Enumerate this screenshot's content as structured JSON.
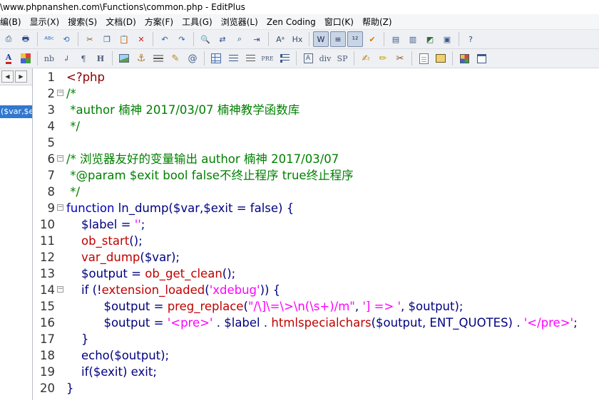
{
  "window": {
    "title": "\\www.phpnanshen.com\\Functions\\common.php - EditPlus"
  },
  "menu": [
    "编(B)",
    "显示(X)",
    "搜索(S)",
    "文档(D)",
    "方案(F)",
    "工具(G)",
    "浏览器(L)",
    "Zen Coding",
    "窗口(K)",
    "帮助(Z)"
  ],
  "toolbar_top": {
    "buttons": [
      {
        "name": "print-preview-icon",
        "glyph": "⎙"
      },
      {
        "name": "print-icon",
        "glyph": "🖶"
      },
      {
        "name": "spell-check-icon",
        "glyph": "ᴬᴮᶜ"
      },
      {
        "name": "reload-icon",
        "glyph": "⟲"
      },
      {
        "name": "cut-icon",
        "glyph": "✂"
      },
      {
        "name": "copy-icon",
        "glyph": "❐"
      },
      {
        "name": "paste-icon",
        "glyph": "📋"
      },
      {
        "name": "delete-icon",
        "glyph": "✕"
      },
      {
        "name": "undo-icon",
        "glyph": "↶"
      },
      {
        "name": "redo-icon",
        "glyph": "↷"
      },
      {
        "name": "find-icon",
        "glyph": "🔍"
      },
      {
        "name": "replace-icon",
        "glyph": "⇄"
      },
      {
        "name": "find-in-files-icon",
        "glyph": "⌕"
      },
      {
        "name": "goto-icon",
        "glyph": "⇥"
      },
      {
        "name": "font-size-icon",
        "glyph": "Aᵃ"
      },
      {
        "name": "hex-icon",
        "glyph": "Hx"
      },
      {
        "name": "word-wrap-icon",
        "glyph": "W"
      },
      {
        "name": "line-number-icon",
        "glyph": "≡"
      },
      {
        "name": "ruler-icon",
        "glyph": "¹²"
      },
      {
        "name": "check-icon",
        "glyph": "✔"
      },
      {
        "name": "window-list-icon",
        "glyph": "▤"
      },
      {
        "name": "split-window-icon",
        "glyph": "▥"
      },
      {
        "name": "browser-preview-icon",
        "glyph": "◩"
      },
      {
        "name": "tile-icon",
        "glyph": "▣"
      },
      {
        "name": "help-icon",
        "glyph": "?"
      }
    ]
  },
  "toolbar_html": {
    "font_color_label": "A",
    "nbsp_label": "nb",
    "br_label": "↲",
    "para_label": "¶",
    "heading_label": "H",
    "div_label": "div",
    "span_label": "SP",
    "pre_label": "PRE"
  },
  "sidebar": {
    "function_entry": "($var,$exit = false)"
  },
  "code_lines": [
    {
      "n": "1",
      "fold": false,
      "tokens": [
        [
          "<?php",
          "t-tag"
        ]
      ]
    },
    {
      "n": "2",
      "fold": true,
      "tokens": [
        [
          "/*",
          "t-com"
        ]
      ]
    },
    {
      "n": "3",
      "fold": false,
      "tokens": [
        [
          " *author 楠神 2017/03/07 楠神教学函数库",
          "t-com"
        ]
      ]
    },
    {
      "n": "4",
      "fold": false,
      "tokens": [
        [
          " */",
          "t-com"
        ]
      ]
    },
    {
      "n": "5",
      "fold": false,
      "tokens": []
    },
    {
      "n": "6",
      "fold": true,
      "tokens": [
        [
          "/* 浏览器友好的变量输出 author 楠神 2017/03/07",
          "t-com"
        ]
      ]
    },
    {
      "n": "7",
      "fold": false,
      "tokens": [
        [
          " *@param $exit bool false不终止程序 true终止程序",
          "t-com"
        ]
      ]
    },
    {
      "n": "8",
      "fold": false,
      "tokens": [
        [
          " */",
          "t-com"
        ]
      ]
    },
    {
      "n": "9",
      "fold": true,
      "tokens": [
        [
          "function ",
          "t-kw"
        ],
        [
          "ln_dump(",
          "t-plain"
        ],
        [
          "$var",
          "t-var"
        ],
        [
          ",",
          "t-plain"
        ],
        [
          "$exit",
          "t-var"
        ],
        [
          " = false) {",
          "t-plain"
        ]
      ]
    },
    {
      "n": "10",
      "fold": false,
      "tokens": [
        [
          "    $label",
          "t-var"
        ],
        [
          " = ",
          "t-plain"
        ],
        [
          "''",
          "t-str"
        ],
        [
          ";",
          "t-plain"
        ]
      ]
    },
    {
      "n": "11",
      "fold": false,
      "tokens": [
        [
          "    ob_start",
          "t-fn"
        ],
        [
          "();",
          "t-plain"
        ]
      ]
    },
    {
      "n": "12",
      "fold": false,
      "tokens": [
        [
          "    var_dump",
          "t-fn"
        ],
        [
          "(",
          "t-plain"
        ],
        [
          "$var",
          "t-var"
        ],
        [
          ");",
          "t-plain"
        ]
      ]
    },
    {
      "n": "13",
      "fold": false,
      "tokens": [
        [
          "    $output",
          "t-var"
        ],
        [
          " = ",
          "t-plain"
        ],
        [
          "ob_get_clean",
          "t-fn"
        ],
        [
          "();",
          "t-plain"
        ]
      ]
    },
    {
      "n": "14",
      "fold": true,
      "tokens": [
        [
          "    if (!",
          "t-plain"
        ],
        [
          "extension_loaded",
          "t-fn"
        ],
        [
          "(",
          "t-plain"
        ],
        [
          "'xdebug'",
          "t-str"
        ],
        [
          ")) {",
          "t-plain"
        ]
      ]
    },
    {
      "n": "15",
      "fold": false,
      "tokens": [
        [
          "          $output",
          "t-var"
        ],
        [
          " = ",
          "t-plain"
        ],
        [
          "preg_replace",
          "t-fn"
        ],
        [
          "(",
          "t-plain"
        ],
        [
          "\"/\\]\\=\\>\\n(\\s+)/m\"",
          "t-str"
        ],
        [
          ", ",
          "t-plain"
        ],
        [
          "'] => '",
          "t-str"
        ],
        [
          ", ",
          "t-plain"
        ],
        [
          "$output",
          "t-var"
        ],
        [
          ");",
          "t-plain"
        ]
      ]
    },
    {
      "n": "16",
      "fold": false,
      "tokens": [
        [
          "          $output",
          "t-var"
        ],
        [
          " = ",
          "t-plain"
        ],
        [
          "'<pre>'",
          "t-str"
        ],
        [
          " . ",
          "t-plain"
        ],
        [
          "$label",
          "t-var"
        ],
        [
          " . ",
          "t-plain"
        ],
        [
          "htmlspecialchars",
          "t-fn"
        ],
        [
          "(",
          "t-plain"
        ],
        [
          "$output",
          "t-var"
        ],
        [
          ", ENT_QUOTES) . ",
          "t-plain"
        ],
        [
          "'</pre>'",
          "t-str"
        ],
        [
          ";",
          "t-plain"
        ]
      ]
    },
    {
      "n": "17",
      "fold": false,
      "tokens": [
        [
          "    }",
          "t-plain"
        ]
      ]
    },
    {
      "n": "18",
      "fold": false,
      "tokens": [
        [
          "    echo(",
          "t-plain"
        ],
        [
          "$output",
          "t-var"
        ],
        [
          ");",
          "t-plain"
        ]
      ]
    },
    {
      "n": "19",
      "fold": false,
      "tokens": [
        [
          "    if(",
          "t-plain"
        ],
        [
          "$exit",
          "t-var"
        ],
        [
          ") exit;",
          "t-plain"
        ]
      ]
    },
    {
      "n": "20",
      "fold": false,
      "tokens": [
        [
          "}",
          "t-plain"
        ]
      ]
    }
  ],
  "colors": {
    "keyword": "#0000c0",
    "comment": "#008000",
    "function": "#c00000",
    "string": "#ff00ff",
    "plain": "#000080",
    "selection": "#3178d0"
  }
}
